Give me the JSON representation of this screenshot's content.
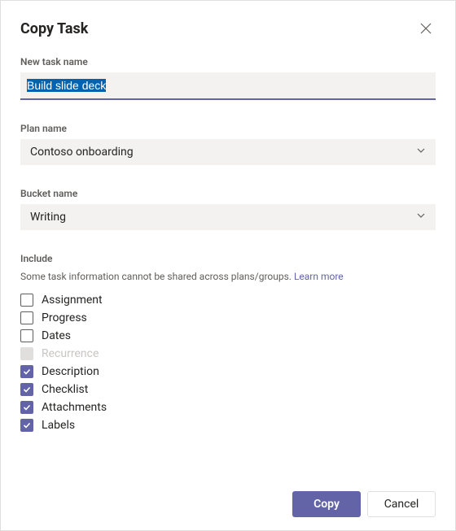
{
  "dialog": {
    "title": "Copy Task"
  },
  "task_name": {
    "label": "New task name",
    "value": "Build slide deck"
  },
  "plan": {
    "label": "Plan name",
    "value": "Contoso onboarding"
  },
  "bucket": {
    "label": "Bucket name",
    "value": "Writing"
  },
  "include": {
    "heading": "Include",
    "helper": "Some task information cannot be shared across plans/groups. ",
    "learn_more": "Learn more",
    "items": [
      {
        "label": "Assignment",
        "checked": false,
        "disabled": false
      },
      {
        "label": "Progress",
        "checked": false,
        "disabled": false
      },
      {
        "label": "Dates",
        "checked": false,
        "disabled": false
      },
      {
        "label": "Recurrence",
        "checked": false,
        "disabled": true
      },
      {
        "label": "Description",
        "checked": true,
        "disabled": false
      },
      {
        "label": "Checklist",
        "checked": true,
        "disabled": false
      },
      {
        "label": "Attachments",
        "checked": true,
        "disabled": false
      },
      {
        "label": "Labels",
        "checked": true,
        "disabled": false
      }
    ]
  },
  "buttons": {
    "primary": "Copy",
    "secondary": "Cancel"
  }
}
